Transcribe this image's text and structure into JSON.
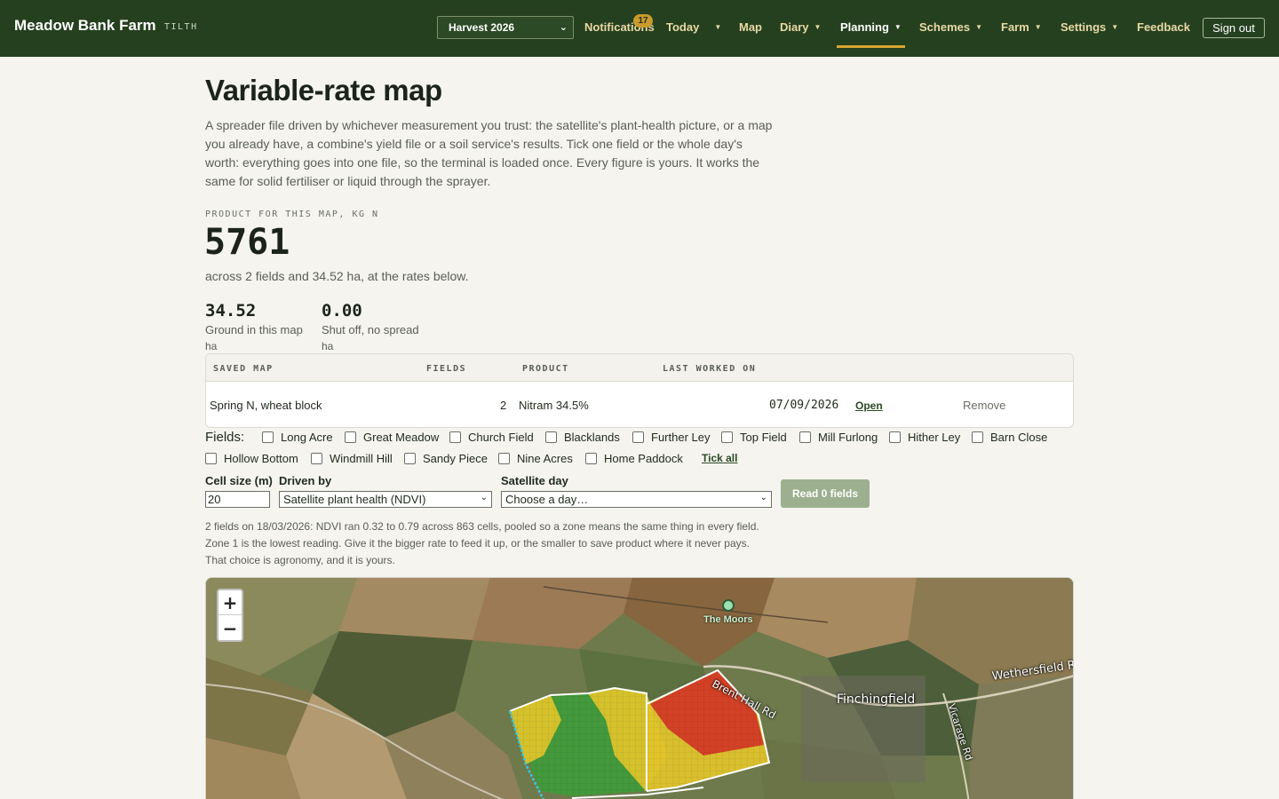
{
  "nav": {
    "brand": "Meadow Bank Farm",
    "brand_tag": "TILTH",
    "season": "Harvest 2026",
    "notifications_label": "Notifications",
    "notifications_count": "17",
    "items": [
      "Today",
      "Map",
      "Diary",
      "Planning",
      "Schemes",
      "Farm",
      "Settings",
      "Feedback"
    ],
    "active": "Planning",
    "sign_out": "Sign out"
  },
  "page": {
    "title": "Variable-rate map",
    "intro": "A spreader file driven by whichever measurement you trust: the satellite's plant-health picture, or a map you already have, a combine's yield file or a soil service's results. Tick one field or the whole day's worth: everything goes into one file, so the terminal is loaded once. Every figure is yours. It works the same for solid fertiliser or liquid through the sprayer.",
    "product_eyebrow": "PRODUCT FOR THIS MAP, KG N",
    "product_total": "5761",
    "product_sub": "across 2 fields and 34.52 ha, at the rates below.",
    "stats": [
      {
        "value": "34.52",
        "label": "Ground in this map",
        "unit": "ha"
      },
      {
        "value": "0.00",
        "label": "Shut off, no spread",
        "unit": "ha"
      }
    ]
  },
  "saved_maps": {
    "headers": {
      "name": "SAVED MAP",
      "fields": "FIELDS",
      "product": "PRODUCT",
      "last": "LAST WORKED ON"
    },
    "rows": [
      {
        "name": "Spring N, wheat block",
        "fields": "2",
        "product": "Nitram 34.5%",
        "last": "07/09/2026",
        "open": "Open",
        "remove": "Remove"
      }
    ]
  },
  "fields": {
    "label": "Fields:",
    "items": [
      "Long Acre",
      "Great Meadow",
      "Church Field",
      "Blacklands",
      "Further Ley",
      "Top Field",
      "Mill Furlong",
      "Hither Ley",
      "Barn Close",
      "Hollow Bottom",
      "Windmill Hill",
      "Sandy Piece",
      "Nine Acres",
      "Home Paddock"
    ],
    "tick_all": "Tick all"
  },
  "form": {
    "cell_size_label": "Cell size (m)",
    "cell_size_value": "20",
    "driven_by_label": "Driven by",
    "driven_by_value": "Satellite plant health (NDVI)",
    "satellite_day_label": "Satellite day",
    "satellite_day_value": "Choose a day…",
    "read_button": "Read 0 fields"
  },
  "hint": {
    "line1": "2 fields on 18/03/2026: NDVI ran 0.32 to 0.79 across 863 cells, pooled so a zone means the same thing in every field.",
    "line2": "Zone 1 is the lowest reading. Give it the bigger rate to feed it up, or the smaller to save product where it never pays.",
    "line3": "That choice is agronomy, and it is yours."
  },
  "map": {
    "zoom_in": "+",
    "zoom_out": "−",
    "poi": "The Moors",
    "labels": [
      "Finchingfield",
      "Brent Hall Rd",
      "Wethersfield R",
      "Vicarage Rd"
    ],
    "zone_colors": {
      "low": "#d23a26",
      "mid": "#e2c42a",
      "high": "#3f9b3a"
    }
  }
}
